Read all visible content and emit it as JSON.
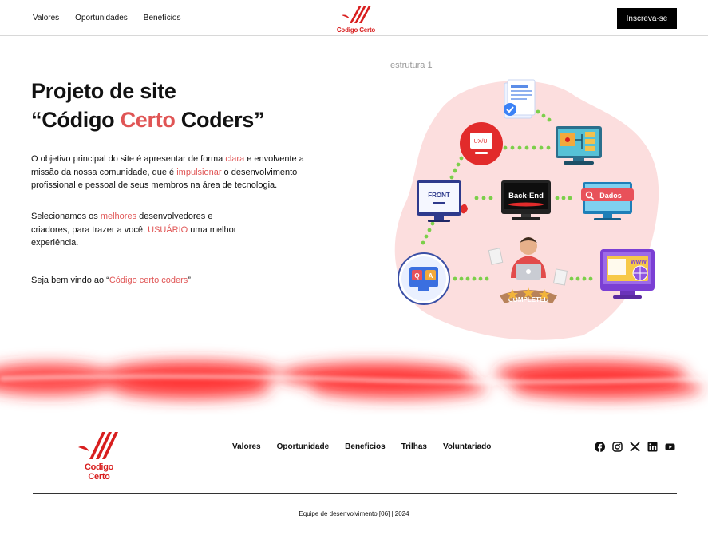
{
  "header": {
    "nav": [
      "Valores",
      "Oportunidades",
      "Benefícios"
    ],
    "logo_text": "Codigo Certo",
    "cta_label": "Inscreva-se"
  },
  "hero": {
    "title_line1": "Projeto de site",
    "title_q_open": "“Código ",
    "title_accent": "Certo",
    "title_q_close": " Coders”",
    "p1": {
      "t1": "O objetivo principal do site é apresentar de forma ",
      "a1": "clara",
      "t2": " e envolvente a missão da nossa comunidade, que é ",
      "a2": "impulsionar",
      "t3": " o desenvolvimento profissional e pessoal de seus membros na área de tecnologia."
    },
    "p2": {
      "t1": "Selecionamos os ",
      "a1": "melhores",
      "t2": " desenvolvedores e criadores, para trazer a você, ",
      "a2": "USUÁRIO",
      "t3": " uma melhor experiência."
    },
    "p3": {
      "t1": "Seja bem vindo ao “",
      "a1": "Código certo coders",
      "t2": "”"
    },
    "caption": "estrutura 1",
    "diagram": {
      "ux_label": "UX/UI",
      "front_label": "FRONT",
      "back_label": "Back-End",
      "dados_label": "Dados",
      "qa_label": "QA",
      "completed_label": "COMPLETED",
      "www_label": "WWW"
    }
  },
  "footer": {
    "logo_text": "Codigo Certo",
    "nav": [
      "Valores",
      "Oportunidade",
      "Beneficios",
      "Trilhas",
      "Voluntariado"
    ],
    "social": [
      "facebook-icon",
      "instagram-icon",
      "x-icon",
      "linkedin-icon",
      "youtube-icon"
    ],
    "credit": "Equipe de desenvolvimento [06] | 2024"
  },
  "colors": {
    "accent": "#e05555",
    "brand_red": "#d81e1e",
    "cta_bg": "#000000"
  }
}
